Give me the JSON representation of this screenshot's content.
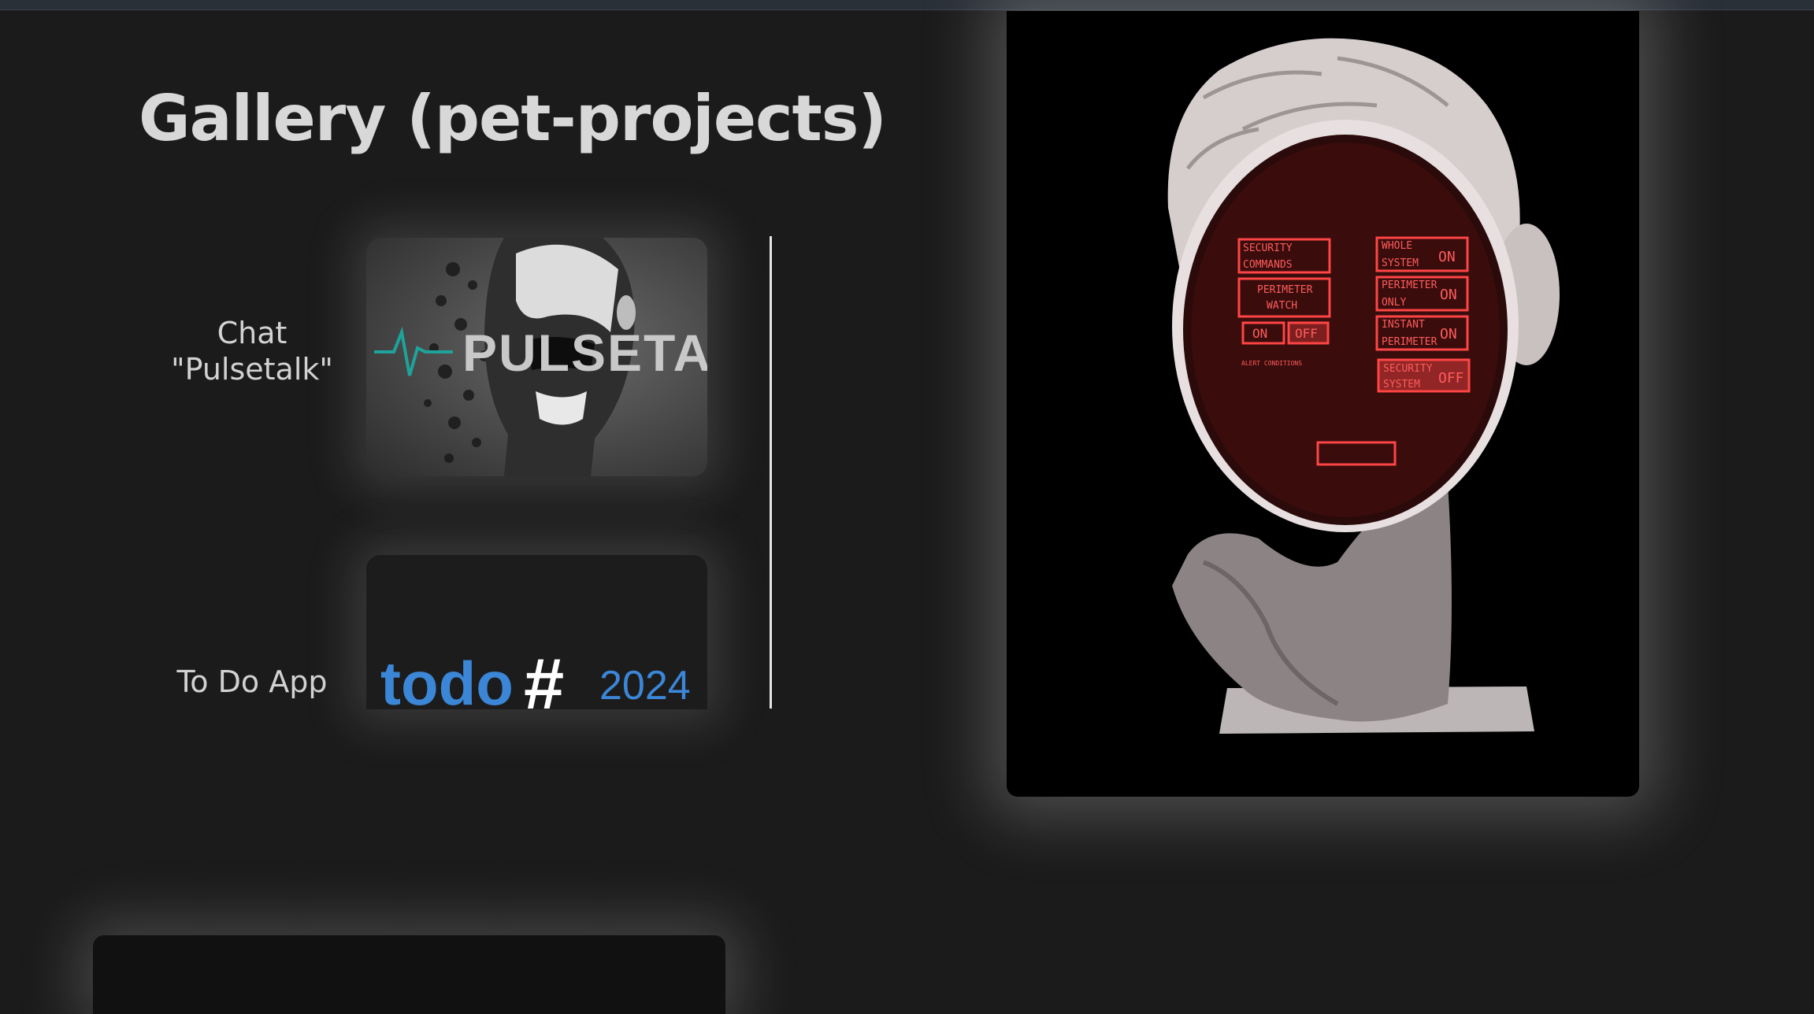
{
  "page": {
    "title": "Gallery (pet-projects)"
  },
  "gallery": {
    "items": [
      {
        "label": "Chat\n\"Pulsetalk\"",
        "thumb_text": "PULSETALK"
      },
      {
        "label": "To Do App",
        "thumb_text": "todo",
        "thumb_symbol": "#",
        "thumb_year": "2024"
      }
    ]
  },
  "hero": {
    "screen": {
      "left_panels": [
        "SECURITY COMMANDS",
        "PERIMETER WATCH",
        "ON",
        "OFF"
      ],
      "right_panels": [
        "WHOLE SYSTEM",
        "ON",
        "PERIMETER ONLY",
        "ON",
        "INSTANT PERIMETER",
        "ON",
        "SECURITY SYSTEM",
        "OFF"
      ],
      "note": "ALERT CONDITIONS"
    }
  }
}
